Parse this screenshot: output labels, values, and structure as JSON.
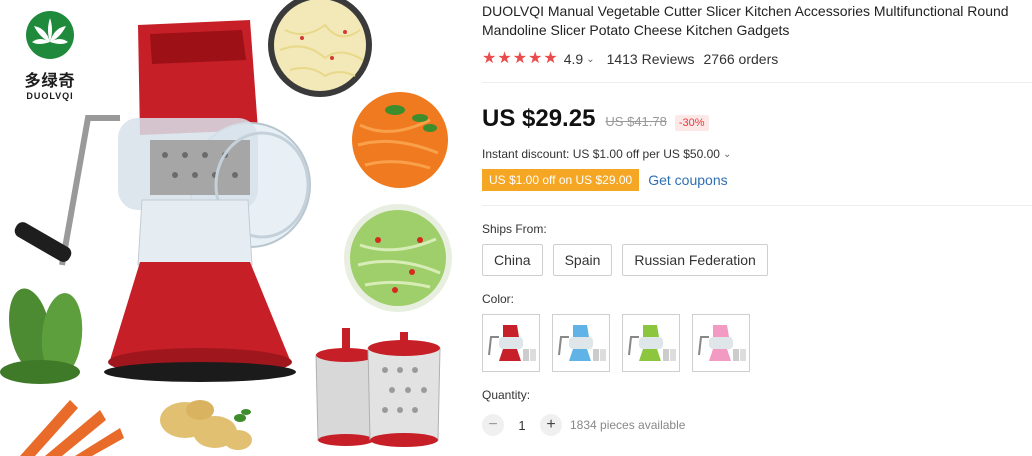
{
  "brand": {
    "name_cn": "多绿奇",
    "name_en": "DUOLVQI"
  },
  "product": {
    "title": "DUOLVQI Manual Vegetable Cutter Slicer Kitchen Accessories Multifunctional Round Mandoline Slicer Potato Cheese Kitchen Gadgets",
    "rating": "4.9",
    "reviews": "1413 Reviews",
    "orders": "2766 orders",
    "price": "US $29.25",
    "old_price": "US $41.78",
    "discount": "-30%",
    "instant_discount": "Instant discount: US $1.00 off per US $50.00",
    "coupon": "US $1.00 off on US $29.00",
    "get_coupons": "Get coupons"
  },
  "ships_from": {
    "label": "Ships From:",
    "options": [
      "China",
      "Spain",
      "Russian Federation"
    ]
  },
  "color": {
    "label": "Color:",
    "options": [
      {
        "name": "red",
        "hex": "#c8202a"
      },
      {
        "name": "blue",
        "hex": "#5fb3e6"
      },
      {
        "name": "green",
        "hex": "#8cc63f"
      },
      {
        "name": "pink",
        "hex": "#f29ac2"
      }
    ]
  },
  "quantity": {
    "label": "Quantity:",
    "value": "1",
    "minus": "−",
    "plus": "+",
    "available": "1834 pieces available"
  },
  "icons": {
    "star": "star-icon",
    "chevron": "chevron-down-icon"
  },
  "colors": {
    "accent_red": "#ea4b4b",
    "coupon_orange": "#f5a623",
    "link_blue": "#2f6fb3"
  }
}
